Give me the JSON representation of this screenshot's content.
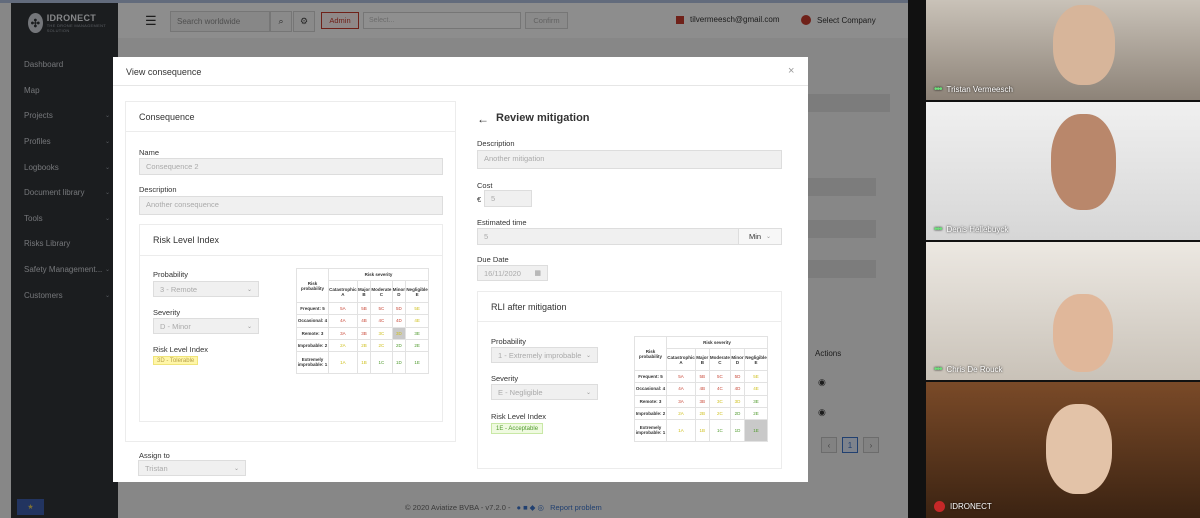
{
  "sidebar": {
    "logo": "IDRONECT",
    "logo_sub": "THE DRONE MANAGEMENT SOLUTION",
    "items": [
      {
        "label": "Dashboard",
        "chevron": false
      },
      {
        "label": "Map",
        "chevron": false
      },
      {
        "label": "Projects",
        "chevron": true
      },
      {
        "label": "Profiles",
        "chevron": true
      },
      {
        "label": "Logbooks",
        "chevron": true
      },
      {
        "label": "Document library",
        "chevron": true
      },
      {
        "label": "Tools",
        "chevron": true
      },
      {
        "label": "Risks Library",
        "chevron": false
      },
      {
        "label": "Safety Management...",
        "chevron": true
      },
      {
        "label": "Customers",
        "chevron": true
      }
    ]
  },
  "topbar": {
    "search_placeholder": "Search worldwide",
    "admin_label": "Admin",
    "select_placeholder": "Select...",
    "confirm_label": "Confirm",
    "email": "tilvermeesch@gmail.com",
    "company_label": "Select Company"
  },
  "background": {
    "actions_header": "Actions",
    "page_number": "1"
  },
  "footer": {
    "copyright": "© 2020 Aviatize BVBA - v7.2.0 -",
    "report": "Report problem"
  },
  "modal": {
    "title": "View consequence",
    "consequence": {
      "title": "Consequence",
      "name_label": "Name",
      "name_value": "Consequence 2",
      "description_label": "Description",
      "description_value": "Another consequence",
      "rli_title": "Risk Level Index",
      "probability_label": "Probability",
      "probability_value": "3 - Remote",
      "severity_label": "Severity",
      "severity_value": "D - Minor",
      "rli_label": "Risk Level Index",
      "rli_value": "3D - Tolerable",
      "assign_label": "Assign to",
      "assign_value": "Tristan"
    },
    "mitigation": {
      "title": "Review mitigation",
      "description_label": "Description",
      "description_value": "Another mitigation",
      "cost_label": "Cost",
      "cost_currency": "€",
      "cost_value": "5",
      "time_label": "Estimated time",
      "time_value": "5",
      "time_unit": "Min",
      "due_label": "Due Date",
      "due_value": "16/11/2020",
      "rli_title": "RLI after mitigation",
      "probability_label": "Probability",
      "probability_value": "1 - Extremely improbable",
      "severity_label": "Severity",
      "severity_value": "E - Negligible",
      "rli_label": "Risk Level Index",
      "rli_value": "1E - Acceptable"
    },
    "matrix": {
      "corner": "Risk probability",
      "severity_header": "Risk severity",
      "columns": [
        "Catastrophic A",
        "Major B",
        "Moderate C",
        "Minor D",
        "Negligible E"
      ],
      "rows": [
        {
          "label": "Frequent: 5",
          "cells": [
            "5A",
            "5B",
            "5C",
            "5D",
            "5E"
          ]
        },
        {
          "label": "Occasional: 4",
          "cells": [
            "4A",
            "4B",
            "4C",
            "4D",
            "4E"
          ]
        },
        {
          "label": "Remote: 3",
          "cells": [
            "3A",
            "3B",
            "3C",
            "3D",
            "3E"
          ]
        },
        {
          "label": "Improbable: 2",
          "cells": [
            "2A",
            "2B",
            "2C",
            "2D",
            "2E"
          ]
        },
        {
          "label": "Extremely improbable: 1",
          "cells": [
            "1A",
            "1B",
            "1C",
            "1D",
            "1E"
          ]
        }
      ]
    }
  },
  "participants": [
    {
      "name": "Tristan Vermeesch",
      "muted": false
    },
    {
      "name": "Denis Hellebuyck",
      "muted": false
    },
    {
      "name": "Chris De Rouck",
      "muted": false
    },
    {
      "name": "IDRONECT",
      "muted": true
    }
  ]
}
